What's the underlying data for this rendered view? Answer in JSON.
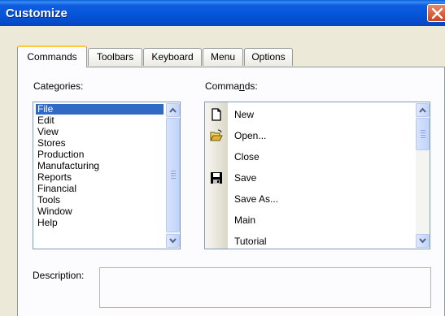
{
  "window": {
    "title": "Customize"
  },
  "tabs": [
    {
      "label": "Commands"
    },
    {
      "label": "Toolbars"
    },
    {
      "label": "Keyboard"
    },
    {
      "label": "Menu"
    },
    {
      "label": "Options"
    }
  ],
  "categories": {
    "label": "Categories:",
    "items": [
      "File",
      "Edit",
      "View",
      "Stores",
      "Production",
      "Manufacturing",
      "Reports",
      "Financial",
      "Tools",
      "Window",
      "Help"
    ],
    "selected": "File"
  },
  "commands": {
    "label_prefix": "Comma",
    "label_accel": "n",
    "label_suffix": "ds:",
    "items": [
      {
        "label": "New",
        "icon": "new-document-icon"
      },
      {
        "label": "Open...",
        "icon": "open-folder-icon"
      },
      {
        "label": "Close",
        "icon": ""
      },
      {
        "label": "Save",
        "icon": "floppy-disk-icon"
      },
      {
        "label": "Save As...",
        "icon": ""
      },
      {
        "label": "Main",
        "icon": ""
      },
      {
        "label": "Tutorial",
        "icon": ""
      }
    ]
  },
  "description": {
    "label": "Description:",
    "text": ""
  }
}
